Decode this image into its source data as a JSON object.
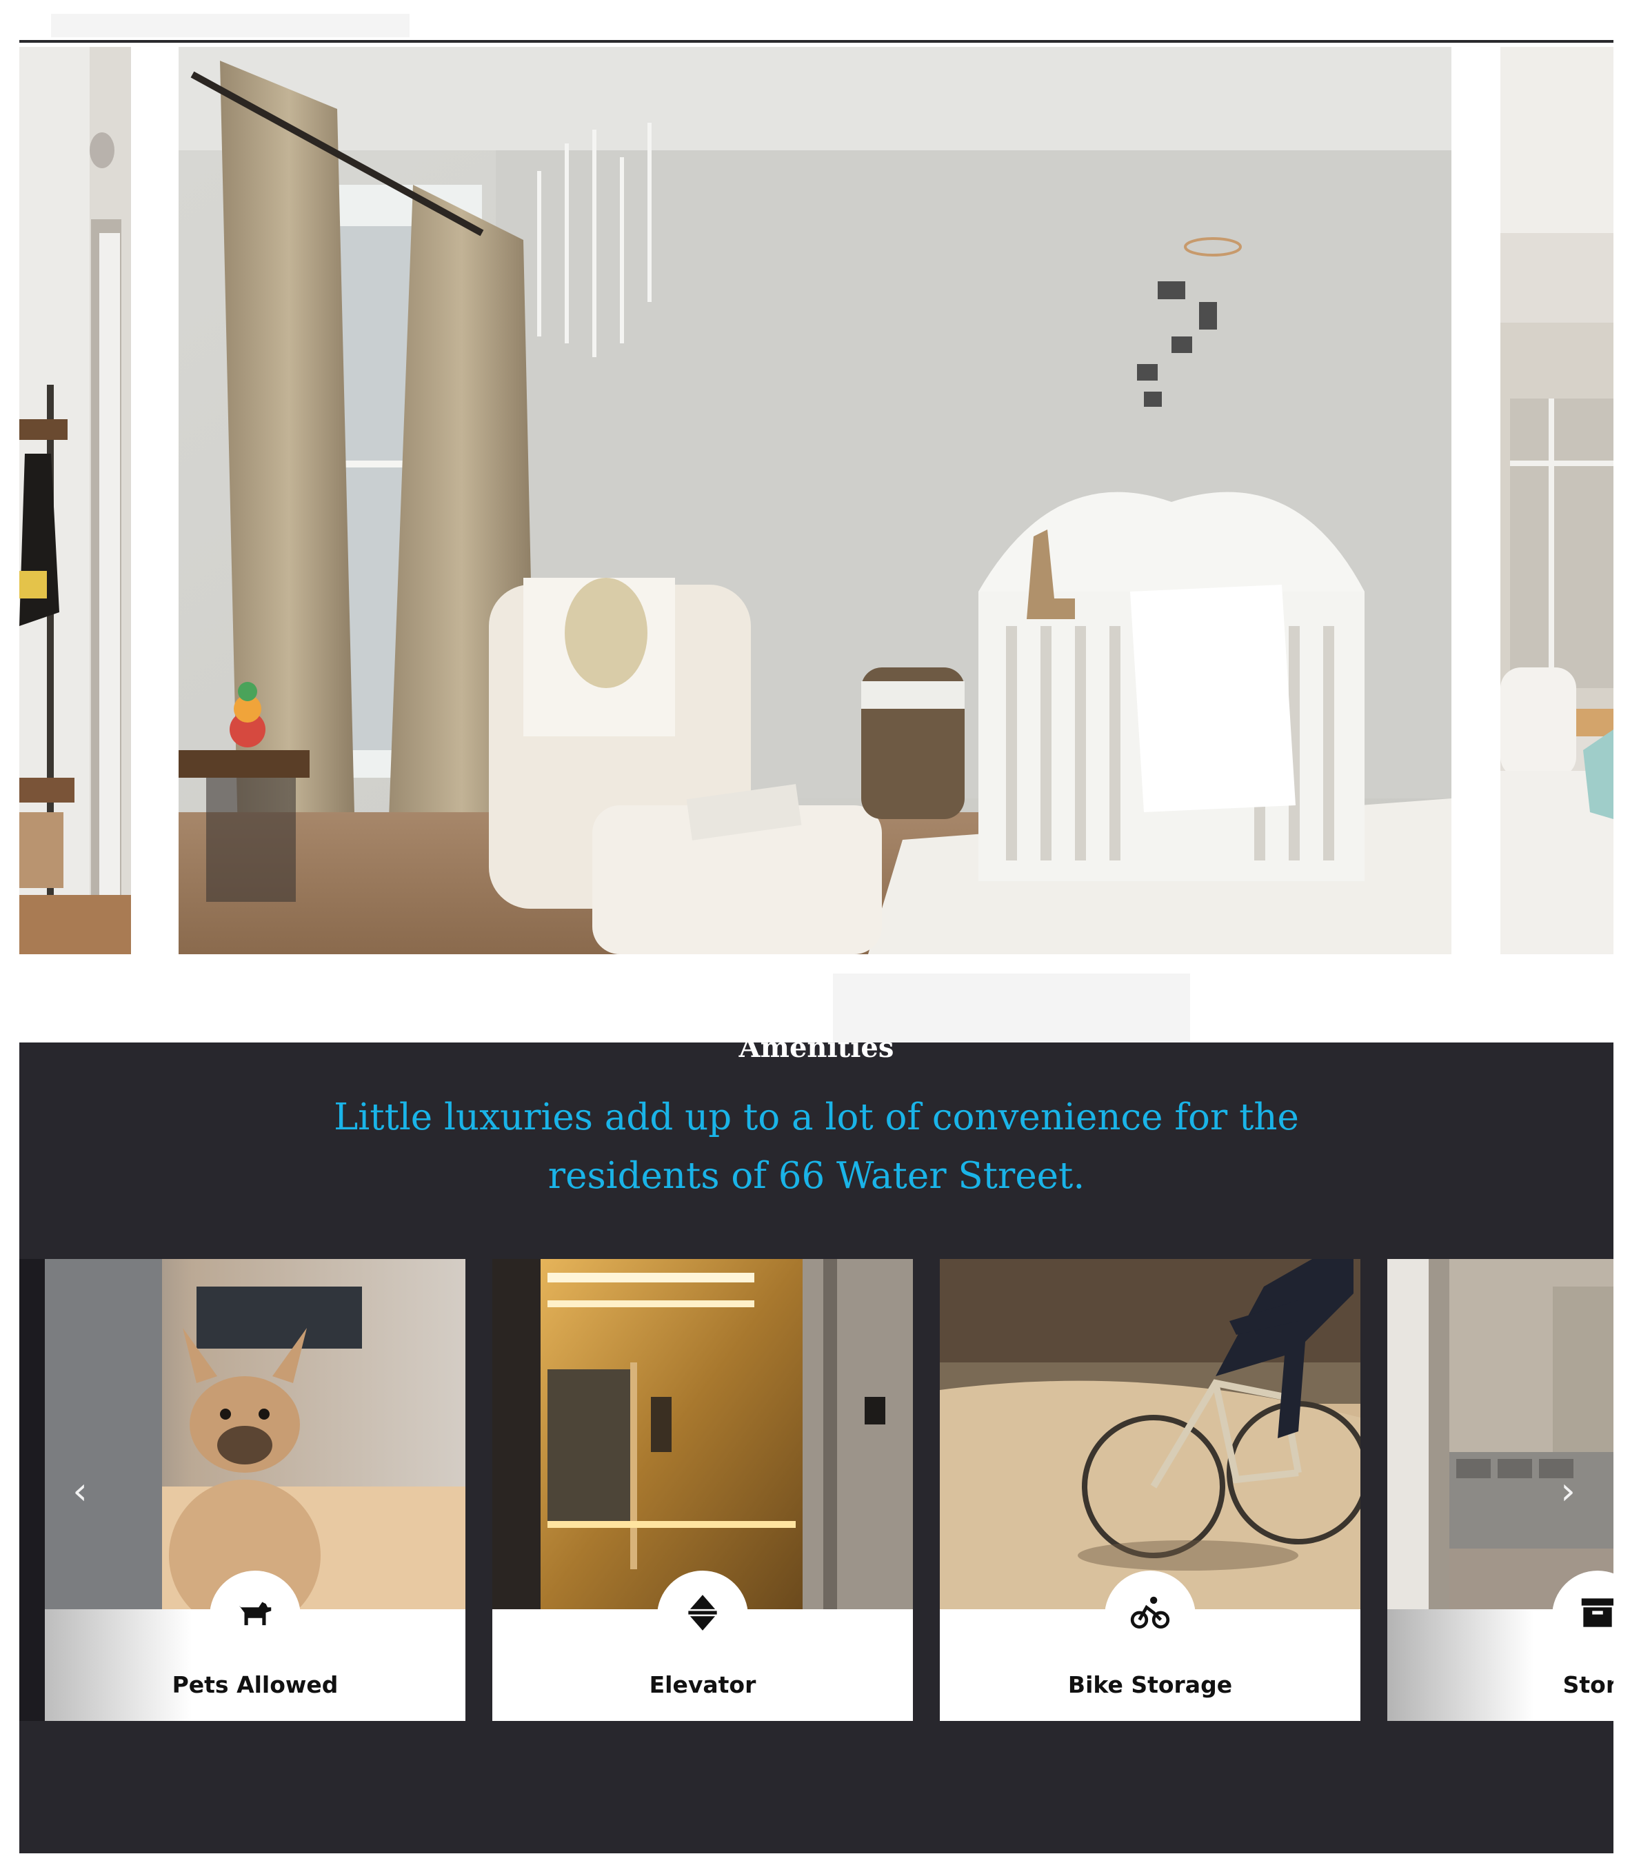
{
  "gallery": {
    "slides": [
      {
        "icon": "entryway-photo"
      },
      {
        "icon": "nursery-photo"
      },
      {
        "icon": "living-room-photo"
      }
    ]
  },
  "amenities": {
    "heading": "Amenities",
    "subtitle_line1": "Little luxuries add up to a lot of convenience for the",
    "subtitle_line2": "residents of 66 Water Street.",
    "prev_arrow": "‹",
    "next_arrow": "›",
    "cards": [
      {
        "label": "Pets Allowed",
        "icon": "dog-icon"
      },
      {
        "label": "Elevator",
        "icon": "elevator-icon"
      },
      {
        "label": "Bike Storage",
        "icon": "bike-icon"
      },
      {
        "label": "Stora",
        "icon": "storage-box-icon"
      }
    ],
    "colors": {
      "background": "#28272d",
      "accent": "#1ab4e8"
    }
  }
}
